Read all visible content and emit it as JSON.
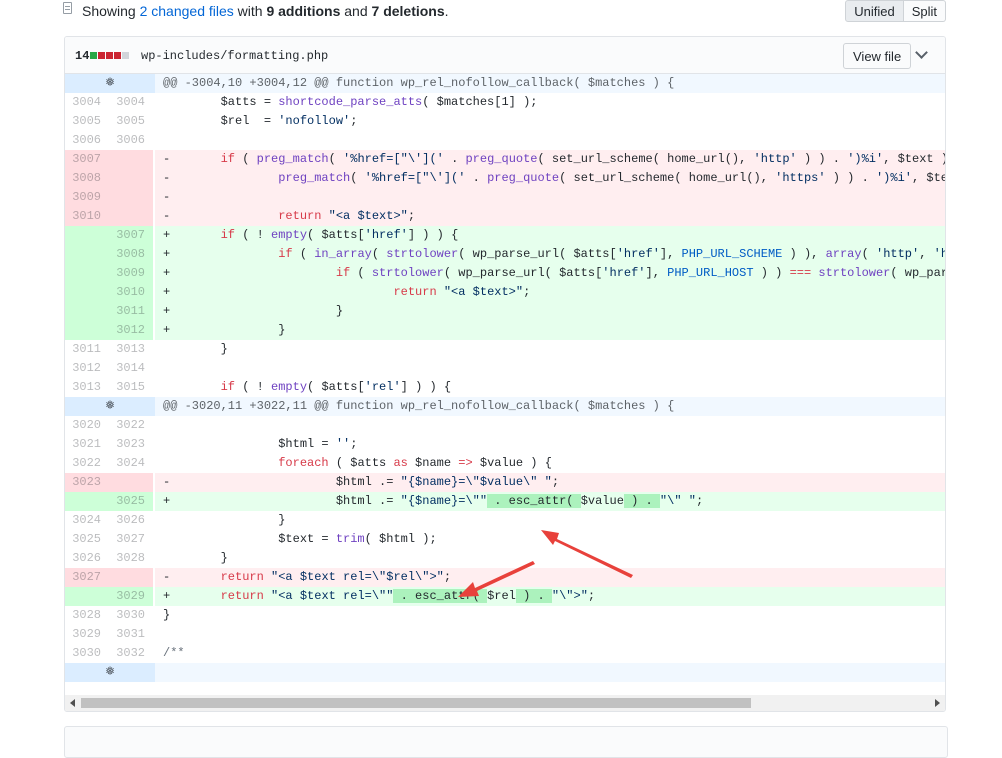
{
  "toc": {
    "prefix": "Showing ",
    "changed_files": "2 changed files",
    "with": " with ",
    "additions": "9 additions",
    "and": " and ",
    "deletions": "7 deletions",
    "suffix": "."
  },
  "view_toggle": {
    "unified": "Unified",
    "split": "Split"
  },
  "file": {
    "stat": "14",
    "stat_blocks": [
      "#28a745",
      "#cb2431",
      "#cb2431",
      "#cb2431",
      "#d1d5da"
    ],
    "name": "wp-includes/formatting.php",
    "view_file": "View file"
  },
  "colors": {
    "addition": "#e6ffed",
    "deletion": "#ffeef0",
    "word_highlight": "#acf2bd",
    "annotation_arrow": "#e8413b"
  },
  "rows": [
    {
      "t": "hunk",
      "h": "@@ -3004,10 +3004,12 @@ function wp_rel_nofollow_callback( $matches ) {"
    },
    {
      "t": "ctx",
      "o": "3004",
      "n": "3004",
      "tokens": [
        [
          "        $atts = "
        ],
        [
          "shortcode_parse_atts",
          "f"
        ],
        [
          "( $matches[1] );"
        ]
      ]
    },
    {
      "t": "ctx",
      "o": "3005",
      "n": "3005",
      "tokens": [
        [
          "        $rel  = "
        ],
        [
          "'nofollow'",
          "s"
        ],
        [
          ";"
        ]
      ]
    },
    {
      "t": "ctx",
      "o": "3006",
      "n": "3006",
      "tokens": [
        [
          ""
        ]
      ]
    },
    {
      "t": "del",
      "o": "3007",
      "n": "",
      "tokens": [
        [
          "-       "
        ],
        [
          "if",
          "k"
        ],
        [
          " ( "
        ],
        [
          "preg_match",
          "f"
        ],
        [
          "( "
        ],
        [
          "'%href=[\"\\']('",
          "s"
        ],
        [
          " . "
        ],
        [
          "preg_quote",
          "f"
        ],
        [
          "( set_url_scheme( home_url(), "
        ],
        [
          "'http'",
          "s"
        ],
        [
          " ) ) . "
        ],
        [
          "')%i'",
          "s"
        ],
        [
          ", $text ) "
        ],
        [
          "||",
          "k"
        ]
      ]
    },
    {
      "t": "del",
      "o": "3008",
      "n": "",
      "tokens": [
        [
          "-               "
        ],
        [
          "preg_match",
          "f"
        ],
        [
          "( "
        ],
        [
          "'%href=[\"\\']('",
          "s"
        ],
        [
          " . "
        ],
        [
          "preg_quote",
          "f"
        ],
        [
          "( set_url_scheme( home_url(), "
        ],
        [
          "'https'",
          "s"
        ],
        [
          " ) ) . "
        ],
        [
          "')%i'",
          "s"
        ],
        [
          ", $text ) )"
        ]
      ]
    },
    {
      "t": "del",
      "o": "3009",
      "n": "",
      "tokens": [
        [
          "-"
        ]
      ]
    },
    {
      "t": "del",
      "o": "3010",
      "n": "",
      "tokens": [
        [
          "-               "
        ],
        [
          "return",
          "k"
        ],
        [
          " "
        ],
        [
          "\"<a $text>\"",
          "s"
        ],
        [
          ";"
        ]
      ]
    },
    {
      "t": "add",
      "o": "",
      "n": "3007",
      "tokens": [
        [
          "+       "
        ],
        [
          "if",
          "k"
        ],
        [
          " ( ! "
        ],
        [
          "empty",
          "f"
        ],
        [
          "( $atts["
        ],
        [
          "'href'",
          "s"
        ],
        [
          "] ) ) {"
        ]
      ]
    },
    {
      "t": "add",
      "o": "",
      "n": "3008",
      "tokens": [
        [
          "+               "
        ],
        [
          "if",
          "k"
        ],
        [
          " ( "
        ],
        [
          "in_array",
          "f"
        ],
        [
          "( "
        ],
        [
          "strtolower",
          "f"
        ],
        [
          "( wp_parse_url( $atts["
        ],
        [
          "'href'",
          "s"
        ],
        [
          "], "
        ],
        [
          "PHP_URL_SCHEME",
          "c"
        ],
        [
          " ) ), "
        ],
        [
          "array",
          "f"
        ],
        [
          "( "
        ],
        [
          "'http'",
          "s"
        ],
        [
          ", "
        ],
        [
          "'https'",
          "s"
        ],
        [
          " ) ) ) {"
        ]
      ]
    },
    {
      "t": "add",
      "o": "",
      "n": "3009",
      "tokens": [
        [
          "+                       "
        ],
        [
          "if",
          "k"
        ],
        [
          " ( "
        ],
        [
          "strtolower",
          "f"
        ],
        [
          "( wp_parse_url( $atts["
        ],
        [
          "'href'",
          "s"
        ],
        [
          "], "
        ],
        [
          "PHP_URL_HOST",
          "c"
        ],
        [
          " ) ) "
        ],
        [
          "===",
          "k"
        ],
        [
          " "
        ],
        [
          "strtolower",
          "f"
        ],
        [
          "( wp_parse_url( home_url(), PHP_URL_HOST ) ) ) {"
        ]
      ]
    },
    {
      "t": "add",
      "o": "",
      "n": "3010",
      "tokens": [
        [
          "+                               "
        ],
        [
          "return",
          "k"
        ],
        [
          " "
        ],
        [
          "\"<a $text>\"",
          "s"
        ],
        [
          ";"
        ]
      ]
    },
    {
      "t": "add",
      "o": "",
      "n": "3011",
      "tokens": [
        [
          "+                       }"
        ]
      ]
    },
    {
      "t": "add",
      "o": "",
      "n": "3012",
      "tokens": [
        [
          "+               }"
        ]
      ]
    },
    {
      "t": "ctx",
      "o": "3011",
      "n": "3013",
      "tokens": [
        [
          "        }"
        ]
      ]
    },
    {
      "t": "ctx",
      "o": "3012",
      "n": "3014",
      "tokens": [
        [
          ""
        ]
      ]
    },
    {
      "t": "ctx",
      "o": "3013",
      "n": "3015",
      "tokens": [
        [
          "        "
        ],
        [
          "if",
          "k"
        ],
        [
          " ( ! "
        ],
        [
          "empty",
          "f"
        ],
        [
          "( $atts["
        ],
        [
          "'rel'",
          "s"
        ],
        [
          "] ) ) {"
        ]
      ]
    },
    {
      "t": "hunk",
      "h": "@@ -3020,11 +3022,11 @@ function wp_rel_nofollow_callback( $matches ) {"
    },
    {
      "t": "ctx",
      "o": "3020",
      "n": "3022",
      "tokens": [
        [
          ""
        ]
      ]
    },
    {
      "t": "ctx",
      "o": "3021",
      "n": "3023",
      "tokens": [
        [
          "                $html = "
        ],
        [
          "''",
          "s"
        ],
        [
          ";"
        ]
      ]
    },
    {
      "t": "ctx",
      "o": "3022",
      "n": "3024",
      "tokens": [
        [
          "                "
        ],
        [
          "foreach",
          "k"
        ],
        [
          " ( $atts "
        ],
        [
          "as",
          "k"
        ],
        [
          " $name "
        ],
        [
          "=>",
          "k"
        ],
        [
          " $value ) {"
        ]
      ]
    },
    {
      "t": "del",
      "o": "3023",
      "n": "",
      "tokens": [
        [
          "-                       $html .= "
        ],
        [
          "\"{$name}=\\\"$value\\\" \"",
          "s"
        ],
        [
          ";"
        ]
      ]
    },
    {
      "t": "add",
      "o": "",
      "n": "3025",
      "tokens": [
        [
          "+                       $html .= "
        ],
        [
          "\"{$name}=\\\"\"",
          "s"
        ],
        [
          " . esc_attr( ",
          "x"
        ],
        [
          "$value"
        ],
        [
          " ) . ",
          "x"
        ],
        [
          "\"\\\" \"",
          "s"
        ],
        [
          ";"
        ]
      ]
    },
    {
      "t": "ctx",
      "o": "3024",
      "n": "3026",
      "tokens": [
        [
          "                }"
        ]
      ]
    },
    {
      "t": "ctx",
      "o": "3025",
      "n": "3027",
      "tokens": [
        [
          "                $text = "
        ],
        [
          "trim",
          "f"
        ],
        [
          "( $html );"
        ]
      ]
    },
    {
      "t": "ctx",
      "o": "3026",
      "n": "3028",
      "tokens": [
        [
          "        }"
        ]
      ]
    },
    {
      "t": "del",
      "o": "3027",
      "n": "",
      "tokens": [
        [
          "-       "
        ],
        [
          "return",
          "k"
        ],
        [
          " "
        ],
        [
          "\"<a $text rel=\\\"$rel\\\">\"",
          "s"
        ],
        [
          ";"
        ]
      ]
    },
    {
      "t": "add",
      "o": "",
      "n": "3029",
      "tokens": [
        [
          "+       "
        ],
        [
          "return",
          "k"
        ],
        [
          " "
        ],
        [
          "\"<a $text rel=\\\"\"",
          "s"
        ],
        [
          " . esc_attr( ",
          "x"
        ],
        [
          "$rel"
        ],
        [
          " ) . ",
          "x"
        ],
        [
          "\"\\\">\"",
          "s"
        ],
        [
          ";"
        ]
      ]
    },
    {
      "t": "ctx",
      "o": "3028",
      "n": "3030",
      "tokens": [
        [
          "}"
        ]
      ]
    },
    {
      "t": "ctx",
      "o": "3029",
      "n": "3031",
      "tokens": [
        [
          ""
        ]
      ]
    },
    {
      "t": "ctx",
      "o": "3030",
      "n": "3032",
      "tokens": [
        [
          "/**",
          "cm"
        ]
      ]
    },
    {
      "t": "hunk",
      "h": ""
    }
  ]
}
